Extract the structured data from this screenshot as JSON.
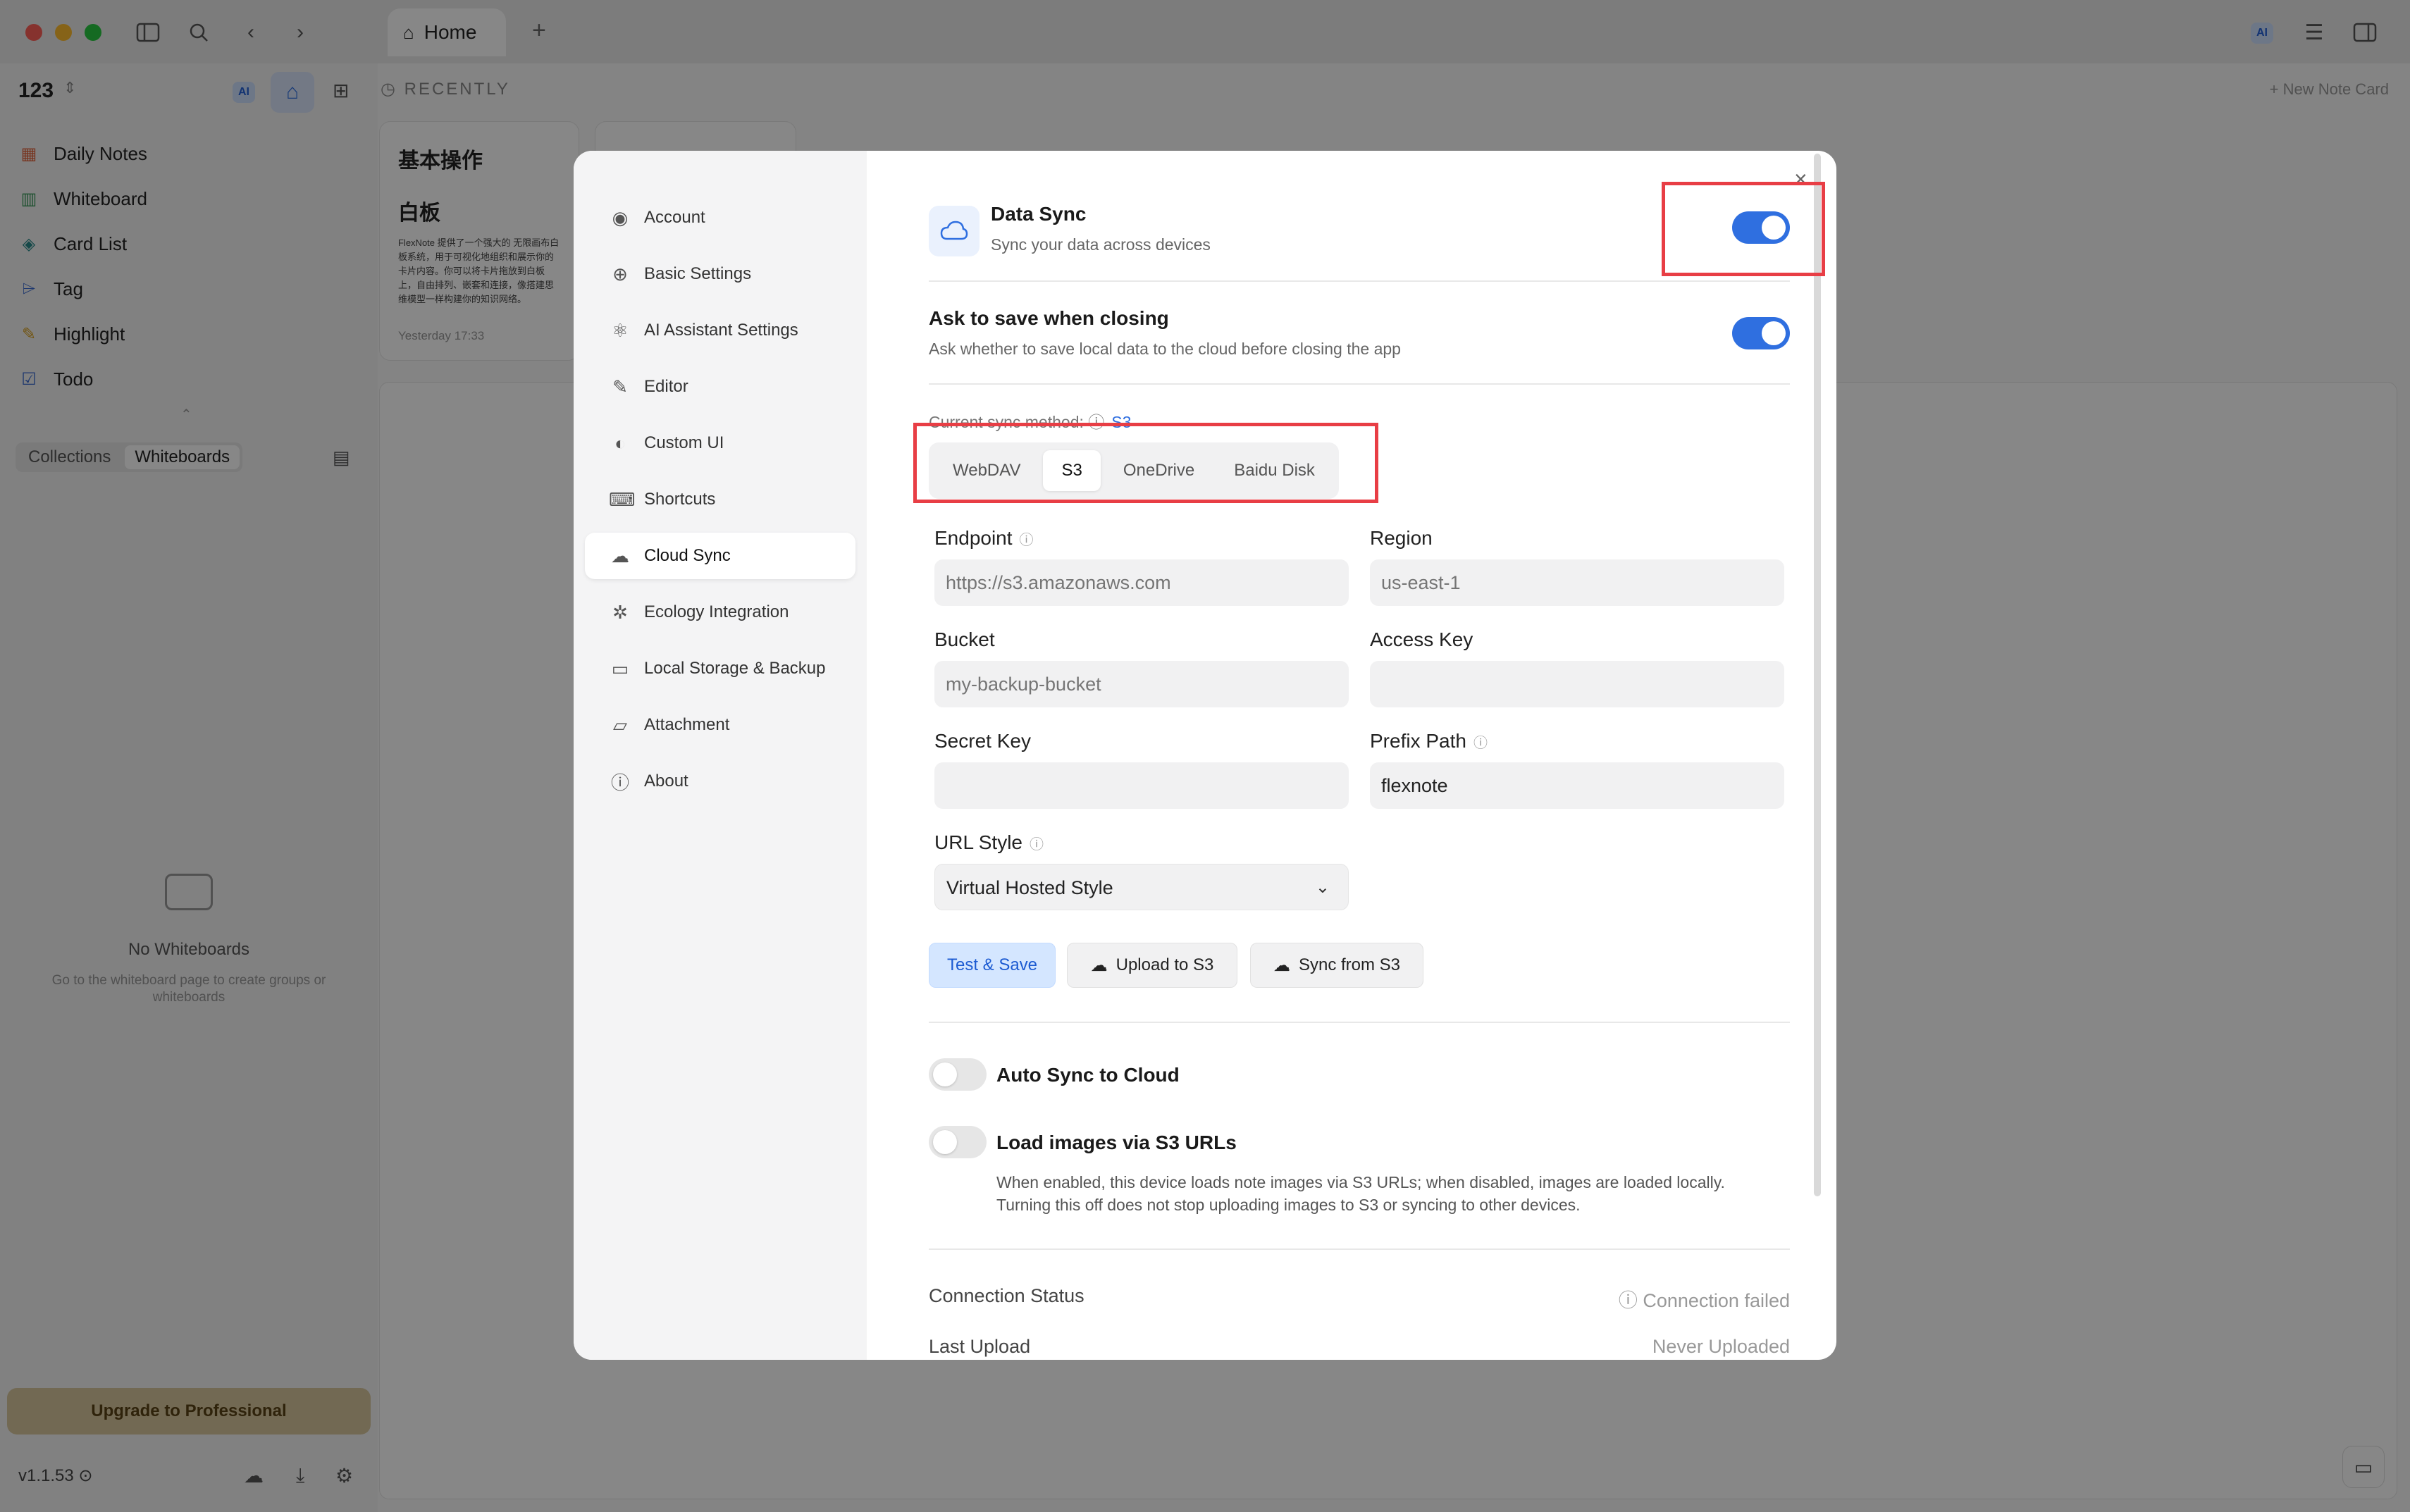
{
  "app": {
    "tab_title": "Home",
    "workspace": "123",
    "ai_badge": "AI",
    "version": "v1.1.53"
  },
  "sidebar": {
    "items": [
      {
        "label": "Daily Notes",
        "icon": "calendar-icon"
      },
      {
        "label": "Whiteboard",
        "icon": "map-icon"
      },
      {
        "label": "Card List",
        "icon": "layers-icon"
      },
      {
        "label": "Tag",
        "icon": "tag-icon"
      },
      {
        "label": "Highlight",
        "icon": "highlighter-icon"
      },
      {
        "label": "Todo",
        "icon": "checkbox-icon"
      }
    ],
    "segments": [
      "Collections",
      "Whiteboards"
    ],
    "empty_title": "No Whiteboards",
    "empty_sub": "Go to the whiteboard page to create groups or whiteboards",
    "upgrade_label": "Upgrade to Professional"
  },
  "main": {
    "recently_label": "RECENTLY",
    "new_note_label": "+ New Note Card",
    "card": {
      "title": "基本操作",
      "heading": "白板",
      "body": "FlexNote 提供了一个强大的 无限画布白板系统，用于可视化地组织和展示你的卡片内容。你可以将卡片拖放到白板上，自由排列、嵌套和连接，像搭建思维模型一样构建你的知识网络。",
      "time": "Yesterday 17:33"
    }
  },
  "settings": {
    "nav": [
      {
        "label": "Account",
        "icon": "user-circle-icon"
      },
      {
        "label": "Basic Settings",
        "icon": "globe-icon"
      },
      {
        "label": "AI Assistant Settings",
        "icon": "ai-atom-icon"
      },
      {
        "label": "Editor",
        "icon": "edit-icon"
      },
      {
        "label": "Custom UI",
        "icon": "palette-icon"
      },
      {
        "label": "Shortcuts",
        "icon": "keyboard-icon"
      },
      {
        "label": "Cloud Sync",
        "icon": "cloud-upload-icon"
      },
      {
        "label": "Ecology Integration",
        "icon": "integration-icon"
      },
      {
        "label": "Local Storage & Backup",
        "icon": "hard-drive-icon"
      },
      {
        "label": "Attachment",
        "icon": "folder-icon"
      },
      {
        "label": "About",
        "icon": "info-icon"
      }
    ],
    "active_nav": "Cloud Sync",
    "data_sync": {
      "title": "Data Sync",
      "subtitle": "Sync your data across devices",
      "enabled": true
    },
    "ask_save": {
      "title": "Ask to save when closing",
      "subtitle": "Ask whether to save local data to the cloud before closing the app",
      "enabled": true
    },
    "method_label": "Current sync method:",
    "method_value": "S3",
    "methods": [
      "WebDAV",
      "S3",
      "OneDrive",
      "Baidu Disk"
    ],
    "selected_method": "S3",
    "fields": {
      "endpoint": {
        "label": "Endpoint",
        "value": "",
        "placeholder": "https://s3.amazonaws.com"
      },
      "region": {
        "label": "Region",
        "value": "",
        "placeholder": "us-east-1"
      },
      "bucket": {
        "label": "Bucket",
        "value": "",
        "placeholder": "my-backup-bucket"
      },
      "access_key": {
        "label": "Access Key",
        "value": "",
        "placeholder": ""
      },
      "secret_key": {
        "label": "Secret Key",
        "value": "",
        "placeholder": ""
      },
      "prefix_path": {
        "label": "Prefix Path",
        "value": "flexnote",
        "placeholder": ""
      },
      "url_style": {
        "label": "URL Style",
        "value": "Virtual Hosted Style"
      }
    },
    "buttons": {
      "test_save": "Test & Save",
      "upload": "Upload to S3",
      "sync_from": "Sync from S3"
    },
    "auto_sync": {
      "label": "Auto Sync to Cloud",
      "enabled": false
    },
    "load_images": {
      "label": "Load images via S3 URLs",
      "enabled": false,
      "description": "When enabled, this device loads note images via S3 URLs; when disabled, images are loaded locally. Turning this off does not stop uploading images to S3 or syncing to other devices."
    },
    "status": {
      "connection_label": "Connection Status",
      "connection_value": "Connection failed",
      "upload_label": "Last Upload",
      "upload_value": "Never Uploaded"
    }
  },
  "colors": {
    "accent": "#2f6fe0",
    "highlight_box": "#e83e45",
    "upgrade_bg": "#d8c79e"
  }
}
